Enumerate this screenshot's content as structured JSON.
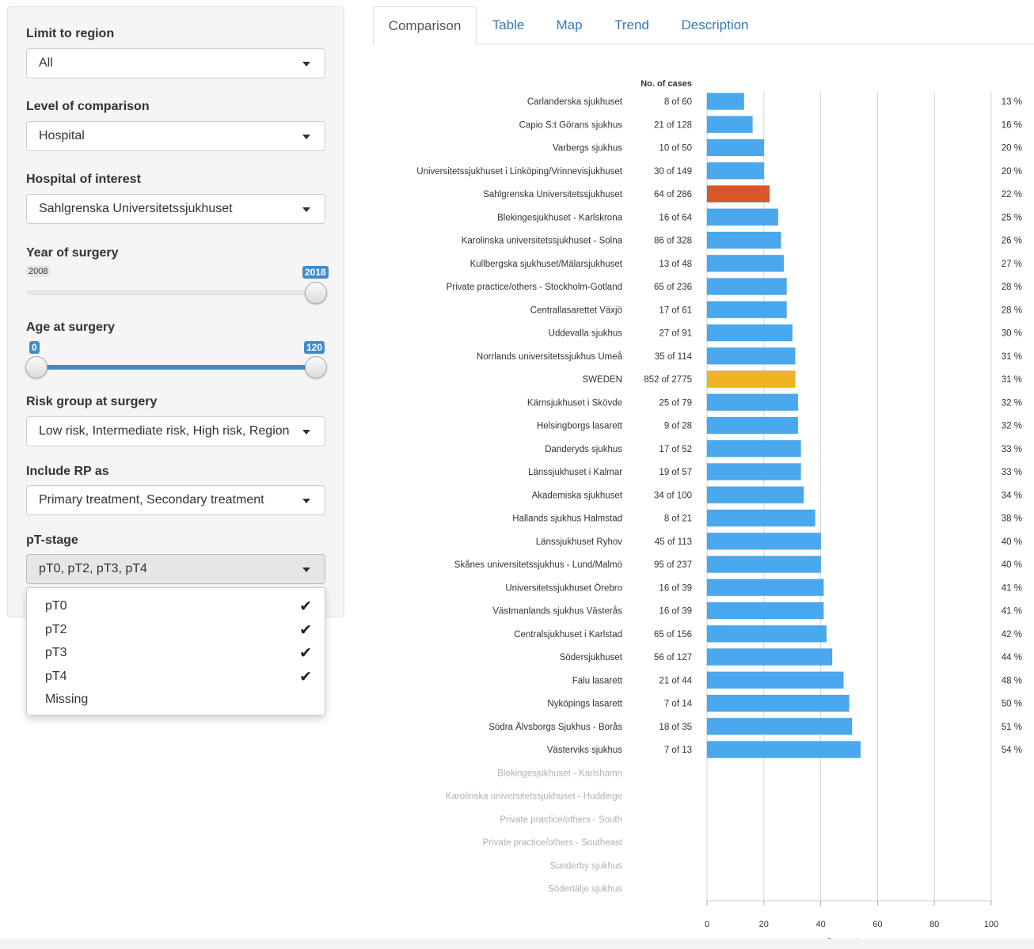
{
  "sidebar": {
    "region": {
      "label": "Limit to region",
      "value": "All"
    },
    "level": {
      "label": "Level of comparison",
      "value": "Hospital"
    },
    "hospital": {
      "label": "Hospital of interest",
      "value": "Sahlgrenska Universitetssjukhuset"
    },
    "year": {
      "label": "Year of surgery",
      "min": "2008",
      "max": "2018",
      "value_fraction": 1.0
    },
    "age": {
      "label": "Age at surgery",
      "min": "0",
      "max": "120",
      "low": "0",
      "high": "120"
    },
    "risk": {
      "label": "Risk group at surgery",
      "value": "Low risk, Intermediate risk, High risk, Region"
    },
    "rp": {
      "label": "Include RP as",
      "value": "Primary treatment, Secondary treatment"
    },
    "pt": {
      "label": "pT-stage",
      "value": "pT0, pT2, pT3, pT4"
    }
  },
  "dropdown": {
    "items": [
      {
        "label": "pT0",
        "checked": true
      },
      {
        "label": "pT2",
        "checked": true
      },
      {
        "label": "pT3",
        "checked": true
      },
      {
        "label": "pT4",
        "checked": true
      },
      {
        "label": "Missing",
        "checked": false
      }
    ],
    "check_glyph": "✔"
  },
  "tabs": [
    "Comparison",
    "Table",
    "Map",
    "Trend",
    "Description"
  ],
  "colors": {
    "bar": "#4aa8ee",
    "highlight": "#d9562b",
    "national": "#f0b323",
    "muted_text": "#b0b0b0"
  },
  "chart_data": {
    "type": "bar",
    "orientation": "horizontal",
    "cases_header": "No. of cases",
    "xlabel": "Percent",
    "xlim": [
      0,
      100
    ],
    "xticks": [
      "0",
      "20",
      "40",
      "60",
      "80",
      "100"
    ],
    "grid": true,
    "rows": [
      {
        "name": "Carlanderska sjukhuset",
        "cases": "8 of 60",
        "value": 13,
        "pct": "13 %",
        "kind": "normal"
      },
      {
        "name": "Capio S:t Görans sjukhus",
        "cases": "21 of 128",
        "value": 16,
        "pct": "16 %",
        "kind": "normal"
      },
      {
        "name": "Varbergs sjukhus",
        "cases": "10 of 50",
        "value": 20,
        "pct": "20 %",
        "kind": "normal"
      },
      {
        "name": "Universitetssjukhuset i Linköping/Vrinnevisjukhuset",
        "cases": "30 of 149",
        "value": 20,
        "pct": "20 %",
        "kind": "normal"
      },
      {
        "name": "Sahlgrenska Universitetssjukhuset",
        "cases": "64 of 286",
        "value": 22,
        "pct": "22 %",
        "kind": "highlight"
      },
      {
        "name": "Blekingesjukhuset - Karlskrona",
        "cases": "16 of 64",
        "value": 25,
        "pct": "25 %",
        "kind": "normal"
      },
      {
        "name": "Karolinska universitetssjukhuset - Solna",
        "cases": "86 of 328",
        "value": 26,
        "pct": "26 %",
        "kind": "normal"
      },
      {
        "name": "Kullbergska sjukhuset/Mälarsjukhuset",
        "cases": "13 of 48",
        "value": 27,
        "pct": "27 %",
        "kind": "normal"
      },
      {
        "name": "Private practice/others - Stockholm-Gotland",
        "cases": "65 of 236",
        "value": 28,
        "pct": "28 %",
        "kind": "normal"
      },
      {
        "name": "Centrallasarettet Växjö",
        "cases": "17 of 61",
        "value": 28,
        "pct": "28 %",
        "kind": "normal"
      },
      {
        "name": "Uddevalla sjukhus",
        "cases": "27 of 91",
        "value": 30,
        "pct": "30 %",
        "kind": "normal"
      },
      {
        "name": "Norrlands universitetssjukhus Umeå",
        "cases": "35 of 114",
        "value": 31,
        "pct": "31 %",
        "kind": "normal"
      },
      {
        "name": "SWEDEN",
        "cases": "852 of 2775",
        "value": 31,
        "pct": "31 %",
        "kind": "national"
      },
      {
        "name": "Kärnsjukhuset i Skövde",
        "cases": "25 of 79",
        "value": 32,
        "pct": "32 %",
        "kind": "normal"
      },
      {
        "name": "Helsingborgs lasarett",
        "cases": "9 of 28",
        "value": 32,
        "pct": "32 %",
        "kind": "normal"
      },
      {
        "name": "Danderyds sjukhus",
        "cases": "17 of 52",
        "value": 33,
        "pct": "33 %",
        "kind": "normal"
      },
      {
        "name": "Länssjukhuset i Kalmar",
        "cases": "19 of 57",
        "value": 33,
        "pct": "33 %",
        "kind": "normal"
      },
      {
        "name": "Akademiska sjukhuset",
        "cases": "34 of 100",
        "value": 34,
        "pct": "34 %",
        "kind": "normal"
      },
      {
        "name": "Hallands sjukhus Halmstad",
        "cases": "8 of 21",
        "value": 38,
        "pct": "38 %",
        "kind": "normal"
      },
      {
        "name": "Länssjukhuset Ryhov",
        "cases": "45 of 113",
        "value": 40,
        "pct": "40 %",
        "kind": "normal"
      },
      {
        "name": "Skånes universitetssjukhus - Lund/Malmö",
        "cases": "95 of 237",
        "value": 40,
        "pct": "40 %",
        "kind": "normal"
      },
      {
        "name": "Universitetssjukhuset Örebro",
        "cases": "16 of 39",
        "value": 41,
        "pct": "41 %",
        "kind": "normal"
      },
      {
        "name": "Västmanlands sjukhus Västerås",
        "cases": "16 of 39",
        "value": 41,
        "pct": "41 %",
        "kind": "normal"
      },
      {
        "name": "Centralsjukhuset i Karlstad",
        "cases": "65 of 156",
        "value": 42,
        "pct": "42 %",
        "kind": "normal"
      },
      {
        "name": "Södersjukhuset",
        "cases": "56 of 127",
        "value": 44,
        "pct": "44 %",
        "kind": "normal"
      },
      {
        "name": "Falu lasarett",
        "cases": "21 of 44",
        "value": 48,
        "pct": "48 %",
        "kind": "normal"
      },
      {
        "name": "Nyköpings lasarett",
        "cases": "7 of 14",
        "value": 50,
        "pct": "50 %",
        "kind": "normal"
      },
      {
        "name": "Södra Älvsborgs Sjukhus - Borås",
        "cases": "18 of 35",
        "value": 51,
        "pct": "51 %",
        "kind": "normal"
      },
      {
        "name": "Västerviks sjukhus",
        "cases": "7 of 13",
        "value": 54,
        "pct": "54 %",
        "kind": "normal"
      },
      {
        "name": "Blekingesjukhuset - Karlshamn",
        "cases": "",
        "value": null,
        "pct": "",
        "kind": "nodata"
      },
      {
        "name": "Karolinska universitetssjukhuset - Huddinge",
        "cases": "",
        "value": null,
        "pct": "",
        "kind": "nodata"
      },
      {
        "name": "Private practice/others - South",
        "cases": "",
        "value": null,
        "pct": "",
        "kind": "nodata"
      },
      {
        "name": "Private practice/others - Southeast",
        "cases": "",
        "value": null,
        "pct": "",
        "kind": "nodata"
      },
      {
        "name": "Sunderby sjukhus",
        "cases": "",
        "value": null,
        "pct": "",
        "kind": "nodata"
      },
      {
        "name": "Södertälje sjukhus",
        "cases": "",
        "value": null,
        "pct": "",
        "kind": "nodata"
      }
    ]
  }
}
